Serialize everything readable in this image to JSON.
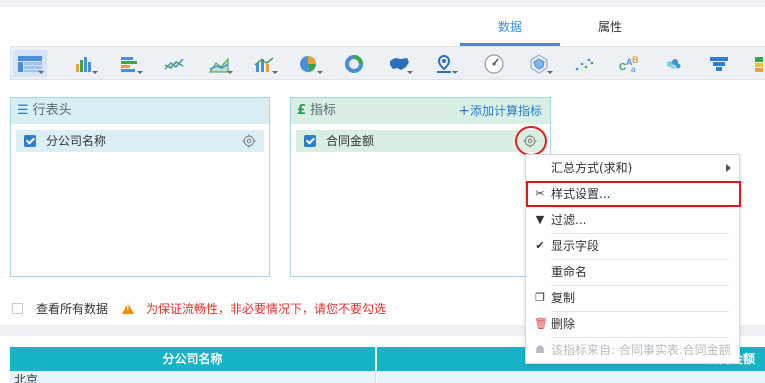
{
  "tabs": [
    {
      "label": "数据",
      "active": true
    },
    {
      "label": "属性",
      "active": false
    }
  ],
  "toolbar": {
    "icons": [
      "table-icon",
      "column-chart-icon",
      "bar-chart-icon",
      "line-chart-icon",
      "area-chart-icon",
      "combo-chart-icon",
      "pie-chart-icon",
      "donut-chart-icon",
      "china-map-icon",
      "point-map-icon",
      "dashboard-gauge-icon",
      "radar-chart-icon",
      "scatter-chart-icon",
      "word-cloud-icon",
      "bubble-icon",
      "funnel-icon",
      "rectangle-tree-icon"
    ]
  },
  "row_panel": {
    "title": "行表头",
    "field": "分公司名称"
  },
  "metric_panel": {
    "title": "指标",
    "add_label": "添加计算指标",
    "field": "合同金额"
  },
  "hint": {
    "checkbox_label": "查看所有数据",
    "warning": "为保证流畅性，非必要情况下，请您不要勾选"
  },
  "table": {
    "headers": [
      "分公司名称",
      "合同金额"
    ],
    "rows": [
      [
        "北京",
        ""
      ]
    ]
  },
  "context_menu": {
    "items": [
      {
        "label": "汇总方式(求和)",
        "icon": "",
        "submenu": true
      },
      {
        "label": "样式设置...",
        "icon": "tools-icon",
        "highlight": true
      },
      {
        "label": "过滤...",
        "icon": "filter-icon"
      },
      {
        "label": "显示字段",
        "icon": "check-icon"
      },
      {
        "label": "重命名",
        "icon": ""
      },
      {
        "label": "复制",
        "icon": "copy-icon"
      },
      {
        "label": "删除",
        "icon": "delete-icon"
      },
      {
        "label": "该指标来自: 合同事实表.合同金额",
        "icon": "lock-icon",
        "disabled": true
      }
    ]
  },
  "colors": {
    "accent": "#3a8ee6",
    "header_teal": "#15b4c7",
    "warning_red": "#e03030",
    "highlight_red": "#d81c1c"
  }
}
